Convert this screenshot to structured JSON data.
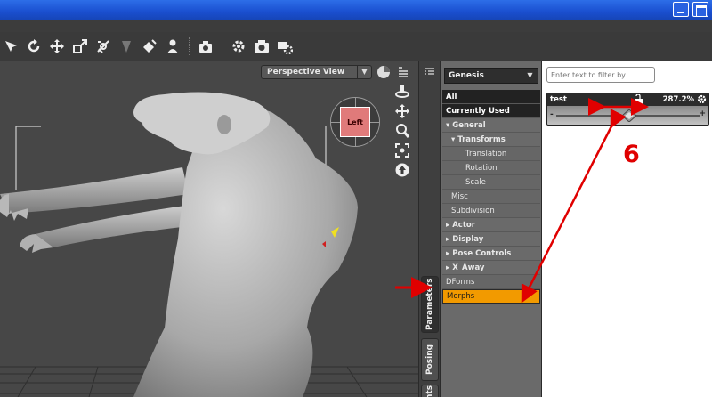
{
  "viewport": {
    "view_label": "Perspective View",
    "cube_face": "Left"
  },
  "tabs": {
    "parameters": "Parameters",
    "posing": "Posing",
    "third": "nts"
  },
  "figure_selector": "Genesis",
  "tree": [
    {
      "label": "All",
      "style": "dark",
      "level": 0
    },
    {
      "label": "Currently Used",
      "style": "dark",
      "level": 0
    },
    {
      "label": "▾ General",
      "style": "cat",
      "level": 0
    },
    {
      "label": "▾ Transforms",
      "style": "cat",
      "level": 1
    },
    {
      "label": "Translation",
      "style": "sub",
      "level": 2
    },
    {
      "label": "Rotation",
      "style": "sub",
      "level": 2
    },
    {
      "label": "Scale",
      "style": "sub",
      "level": 2
    },
    {
      "label": "Misc",
      "style": "sub",
      "level": 1
    },
    {
      "label": "Subdivision",
      "style": "sub",
      "level": 1
    },
    {
      "label": "▸ Actor",
      "style": "cat",
      "level": 0
    },
    {
      "label": "▸ Display",
      "style": "cat",
      "level": 0
    },
    {
      "label": "▸ Pose Controls",
      "style": "cat",
      "level": 0
    },
    {
      "label": "▸ X_Away",
      "style": "cat",
      "level": 0
    },
    {
      "label": "DForms",
      "style": "sub",
      "level": 0
    },
    {
      "label": "Morphs",
      "style": "sel",
      "level": 0
    }
  ],
  "filter": {
    "placeholder": "Enter text to filter by..."
  },
  "property": {
    "name": "test",
    "value": "287.2%",
    "minus": "-",
    "plus": "+"
  },
  "annotation": {
    "number": "6"
  },
  "colors": {
    "title_blue": "#1a4fd0",
    "selected_row": "#f29a00",
    "annotation_red": "#e00000",
    "cube_face": "#e07a7a"
  }
}
